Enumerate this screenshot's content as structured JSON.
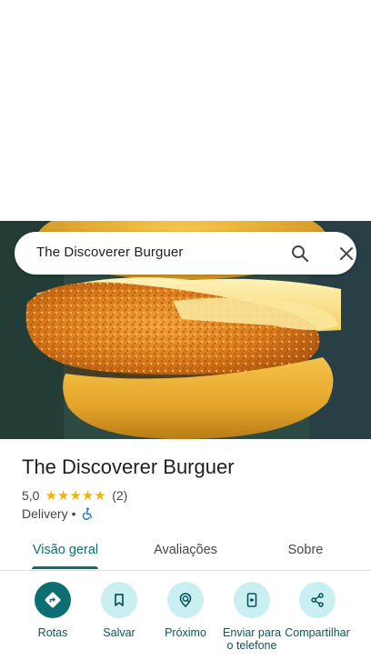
{
  "search": {
    "query": "The Discoverer Burguer"
  },
  "place": {
    "name": "The Discoverer Burguer",
    "rating": "5,0",
    "stars": "★★★★★",
    "review_count": "(2)",
    "category": "Delivery",
    "separator": "•"
  },
  "tabs": [
    {
      "label": "Visão geral",
      "active": true
    },
    {
      "label": "Avaliações",
      "active": false
    },
    {
      "label": "Sobre",
      "active": false
    }
  ],
  "actions": [
    {
      "label": "Rotas",
      "icon": "directions-icon"
    },
    {
      "label": "Salvar",
      "icon": "bookmark-icon"
    },
    {
      "label": "Próximo",
      "icon": "nearby-icon"
    },
    {
      "label": "Enviar para o telefone",
      "icon": "send-to-phone-icon"
    },
    {
      "label": "Compartilhar",
      "icon": "share-icon"
    }
  ],
  "colors": {
    "accent": "#0b6e71",
    "action_bg": "#c9eff2",
    "star": "#f6b400"
  }
}
